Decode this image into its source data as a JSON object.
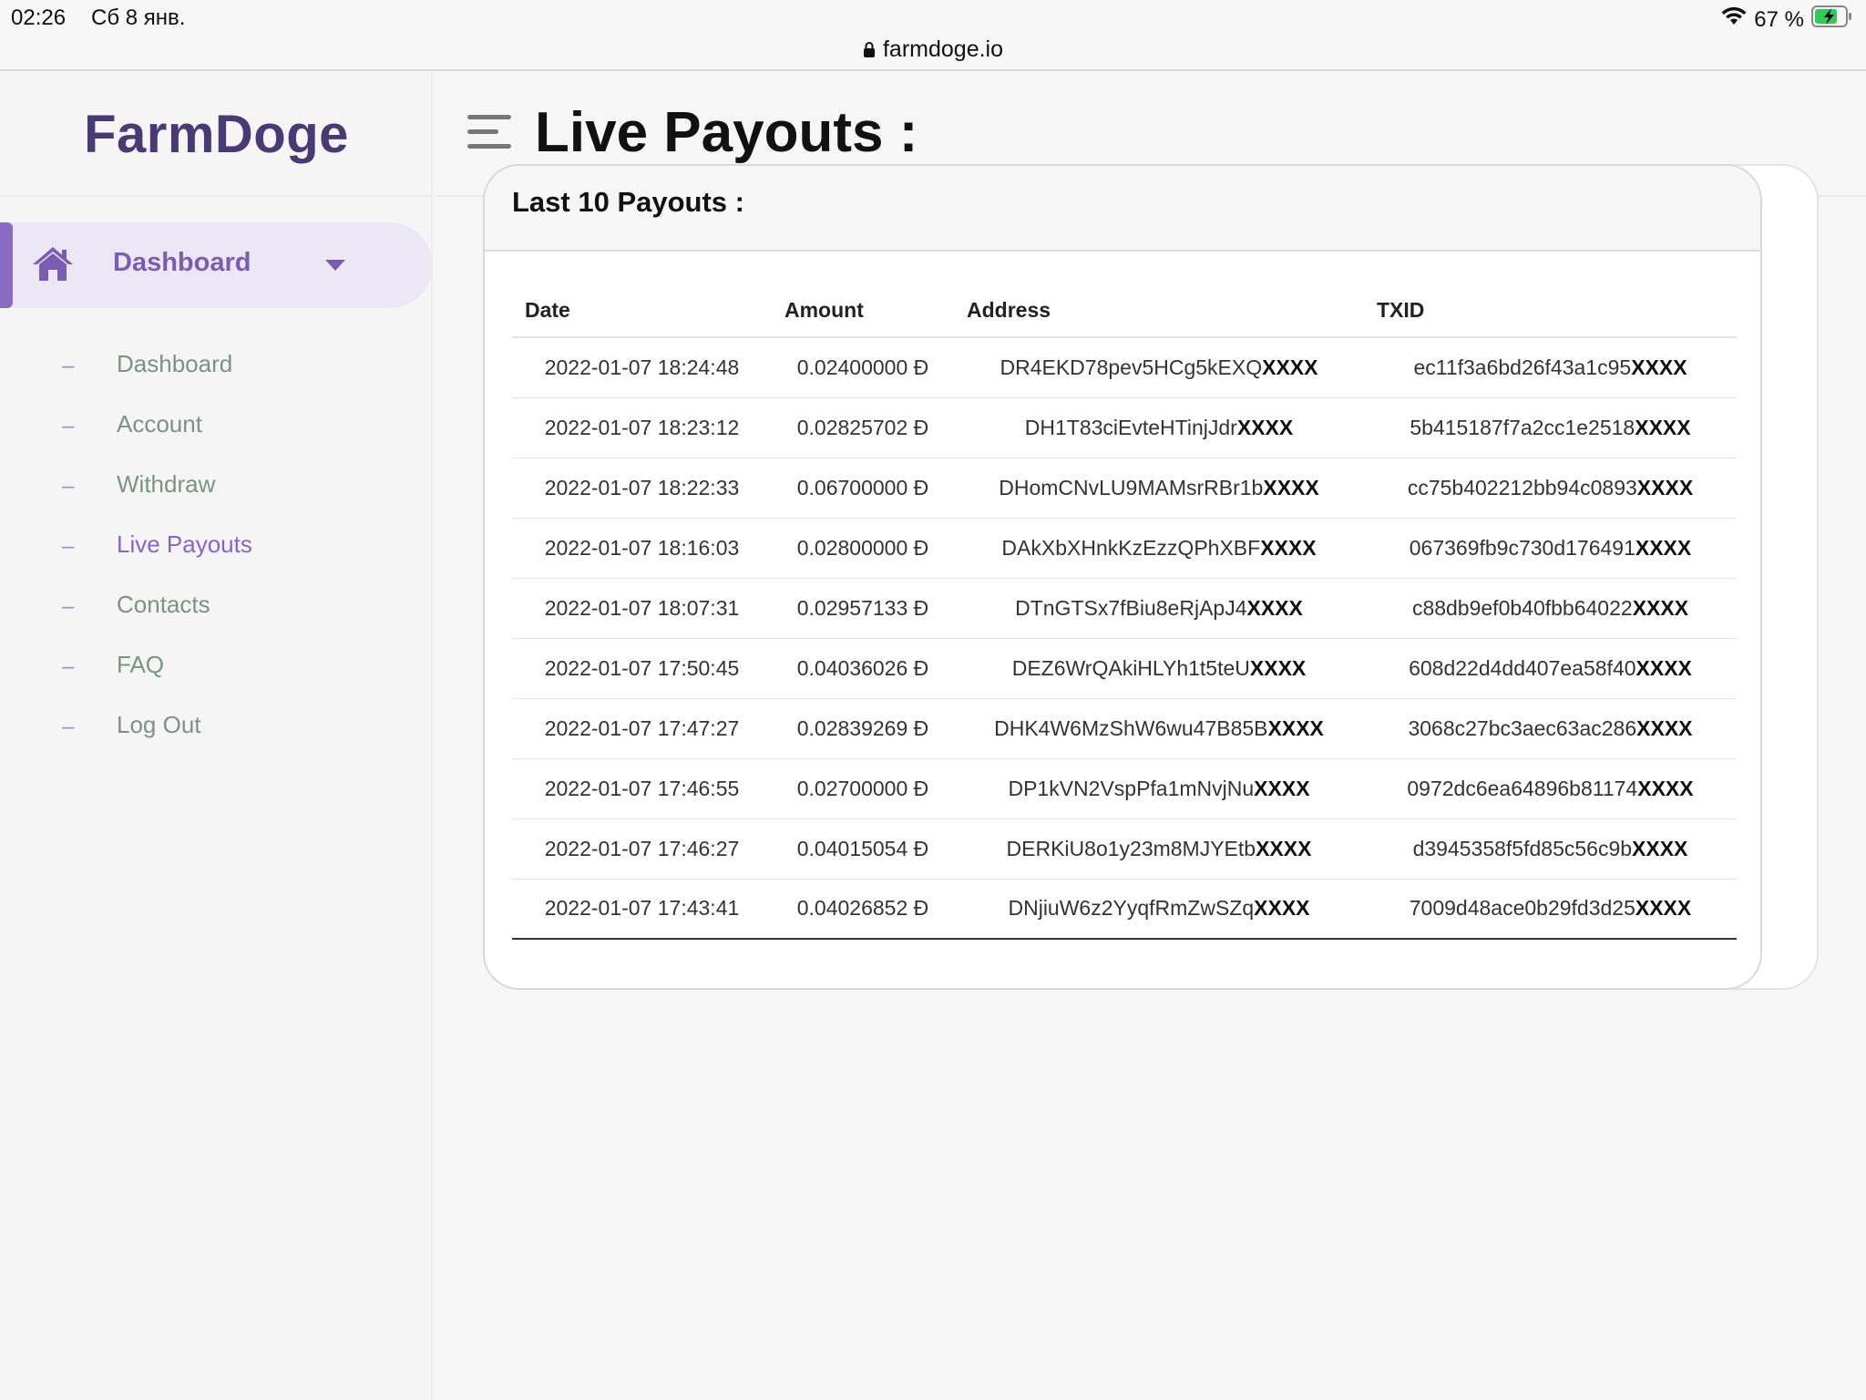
{
  "status_bar": {
    "time": "02:26",
    "date": "Сб 8 янв.",
    "battery": "67 %"
  },
  "browser": {
    "url": "farmdoge.io"
  },
  "sidebar": {
    "brand": "FarmDoge",
    "main_item": "Dashboard",
    "items": [
      {
        "label": "Dashboard",
        "active": false
      },
      {
        "label": "Account",
        "active": false
      },
      {
        "label": "Withdraw",
        "active": false
      },
      {
        "label": "Live Payouts",
        "active": true
      },
      {
        "label": "Contacts",
        "active": false
      },
      {
        "label": "FAQ",
        "active": false
      },
      {
        "label": "Log Out",
        "active": false
      }
    ]
  },
  "page": {
    "title": "Live Payouts :"
  },
  "card": {
    "header": "Last 10 Payouts :",
    "columns": [
      "Date",
      "Amount",
      "Address",
      "TXID"
    ],
    "mask": "XXXX",
    "rows": [
      {
        "date": "2022-01-07 18:24:48",
        "amount": "0.02400000 Đ",
        "address": "DR4EKD78pev5HCg5kEXQ",
        "txid": "ec11f3a6bd26f43a1c95"
      },
      {
        "date": "2022-01-07 18:23:12",
        "amount": "0.02825702 Đ",
        "address": "DH1T83ciEvteHTinjJdr",
        "txid": "5b415187f7a2cc1e2518"
      },
      {
        "date": "2022-01-07 18:22:33",
        "amount": "0.06700000 Đ",
        "address": "DHomCNvLU9MAMsrRBr1b",
        "txid": "cc75b402212bb94c0893"
      },
      {
        "date": "2022-01-07 18:16:03",
        "amount": "0.02800000 Đ",
        "address": "DAkXbXHnkKzEzzQPhXBF",
        "txid": "067369fb9c730d176491"
      },
      {
        "date": "2022-01-07 18:07:31",
        "amount": "0.02957133 Đ",
        "address": "DTnGTSx7fBiu8eRjApJ4",
        "txid": "c88db9ef0b40fbb64022"
      },
      {
        "date": "2022-01-07 17:50:45",
        "amount": "0.04036026 Đ",
        "address": "DEZ6WrQAkiHLYh1t5teU",
        "txid": "608d22d4dd407ea58f40"
      },
      {
        "date": "2022-01-07 17:47:27",
        "amount": "0.02839269 Đ",
        "address": "DHK4W6MzShW6wu47B85B",
        "txid": "3068c27bc3aec63ac286"
      },
      {
        "date": "2022-01-07 17:46:55",
        "amount": "0.02700000 Đ",
        "address": "DP1kVN2VspPfa1mNvjNu",
        "txid": "0972dc6ea64896b81174"
      },
      {
        "date": "2022-01-07 17:46:27",
        "amount": "0.04015054 Đ",
        "address": "DERKiU8o1y23m8MJYEtb",
        "txid": "d3945358f5fd85c56c9b"
      },
      {
        "date": "2022-01-07 17:43:41",
        "amount": "0.04026852 Đ",
        "address": "DNjiuW6z2YyqfRmZwSZq",
        "txid": "7009d48ace0b29fd3d25"
      }
    ]
  },
  "icons": {
    "wifi": "wifi-icon",
    "battery": "battery-icon",
    "lock": "lock-icon",
    "home": "home-icon",
    "caret": "chevron-down-icon",
    "menu": "hamburger-menu-icon"
  },
  "colors": {
    "brand": "#4a3a74",
    "accent": "#8a6cc2",
    "accent_bg": "#ece7f5",
    "nav_text": "#7c9285"
  }
}
